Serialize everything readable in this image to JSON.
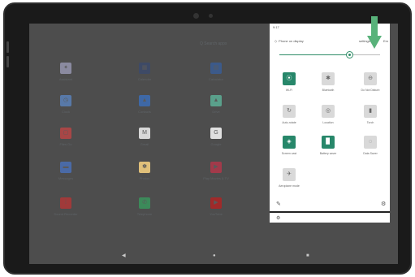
{
  "status_bar": {
    "time": "9:17"
  },
  "home": {
    "search_label": "Q Search apps",
    "apps": [
      [
        "Assistant",
        "Calendar",
        "Calculator"
      ],
      [
        "Clock",
        "Contacts",
        "Drive"
      ],
      [
        "Files Go",
        "Gmail",
        "Google"
      ],
      [
        "Messages",
        "Photos",
        "Play Movies & TV"
      ],
      [
        "Sound Recorder",
        "Telephone",
        "YouTube"
      ]
    ]
  },
  "quick_settings": {
    "phone_status": "Phone on display",
    "settings_label": "settings",
    "right_label": "Em",
    "brightness_percent": 70,
    "tiles": [
      {
        "label": "Wi-Fi",
        "icon": "wifi-icon",
        "on": true,
        "glyph": "⦿"
      },
      {
        "label": "Bluetooth",
        "icon": "bluetooth-icon",
        "on": false,
        "glyph": "✱"
      },
      {
        "label": "Do Not Disturb",
        "icon": "dnd-icon",
        "on": false,
        "glyph": "⊖"
      },
      {
        "label": "Auto-rotate",
        "icon": "rotate-icon",
        "on": false,
        "glyph": "↻"
      },
      {
        "label": "Location",
        "icon": "location-icon",
        "on": false,
        "glyph": "◎"
      },
      {
        "label": "Torch",
        "icon": "torch-icon",
        "on": false,
        "glyph": "▮"
      },
      {
        "label": "Screen cast",
        "icon": "cast-icon",
        "on": true,
        "glyph": "◈"
      },
      {
        "label": "Battery saver",
        "icon": "battery-icon",
        "on": true,
        "glyph": "▉"
      },
      {
        "label": "Data Saver",
        "icon": "data-saver-icon",
        "on": false,
        "glyph": "◌"
      },
      {
        "label": "Aeroplane mode",
        "icon": "airplane-icon",
        "on": false,
        "glyph": "✈"
      }
    ],
    "edit_glyph": "✎",
    "settings_glyph": "⚙"
  },
  "nav": {
    "back": "◀",
    "home": "●",
    "recents": "■"
  },
  "colors": {
    "accent": "#27876a",
    "arrow": "#58b27a"
  }
}
